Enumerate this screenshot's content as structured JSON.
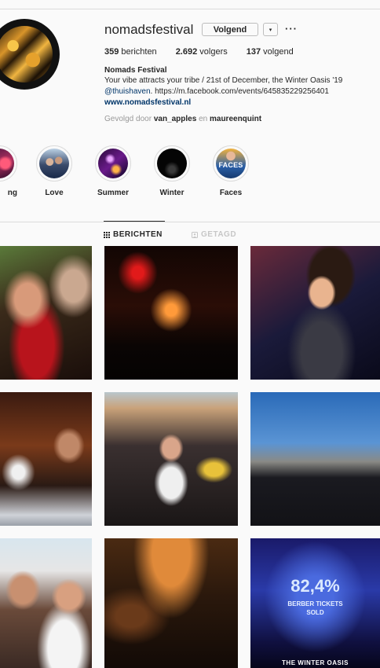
{
  "profile": {
    "username": "nomadsfestival",
    "follow_label": "Volgend",
    "dropdown_glyph": "▾",
    "more_glyph": "···",
    "stats": {
      "posts_count": "359",
      "posts_label": "berichten",
      "followers_count": "2.692",
      "followers_label": "volgers",
      "following_count": "137",
      "following_label": "volgend"
    },
    "full_name": "Nomads Festival",
    "bio_line1": "Your vibe attracts your tribe / 21st of December, the Winter Oasis '19",
    "bio_mention": "@thuishaven",
    "bio_link": ". https://m.facebook.com/events/645835229256401",
    "website": "www.nomadsfestival.nl",
    "followed_by_prefix": "Gevolgd door",
    "followed_by_user1": "van_apples",
    "followed_by_and": "en",
    "followed_by_user2": "maureenquint"
  },
  "highlights": [
    {
      "label": "ng"
    },
    {
      "label": "Love"
    },
    {
      "label": "Summer"
    },
    {
      "label": "Winter"
    },
    {
      "label": "Faces",
      "cover_text": "FACES"
    }
  ],
  "tabs": [
    {
      "label": "BERICHTEN",
      "active": true,
      "icon": "grid-icon"
    },
    {
      "label": "GETAGD",
      "active": false,
      "icon": "tag-icon"
    }
  ],
  "stat_post": {
    "percent": "82,4%",
    "line1": "BERBER TICKETS",
    "line2": "SOLD",
    "footer": "THE WINTER OASIS"
  },
  "colors": {
    "text": "#262626",
    "link": "#003569",
    "muted": "#999999",
    "border": "#dbdbdb"
  }
}
